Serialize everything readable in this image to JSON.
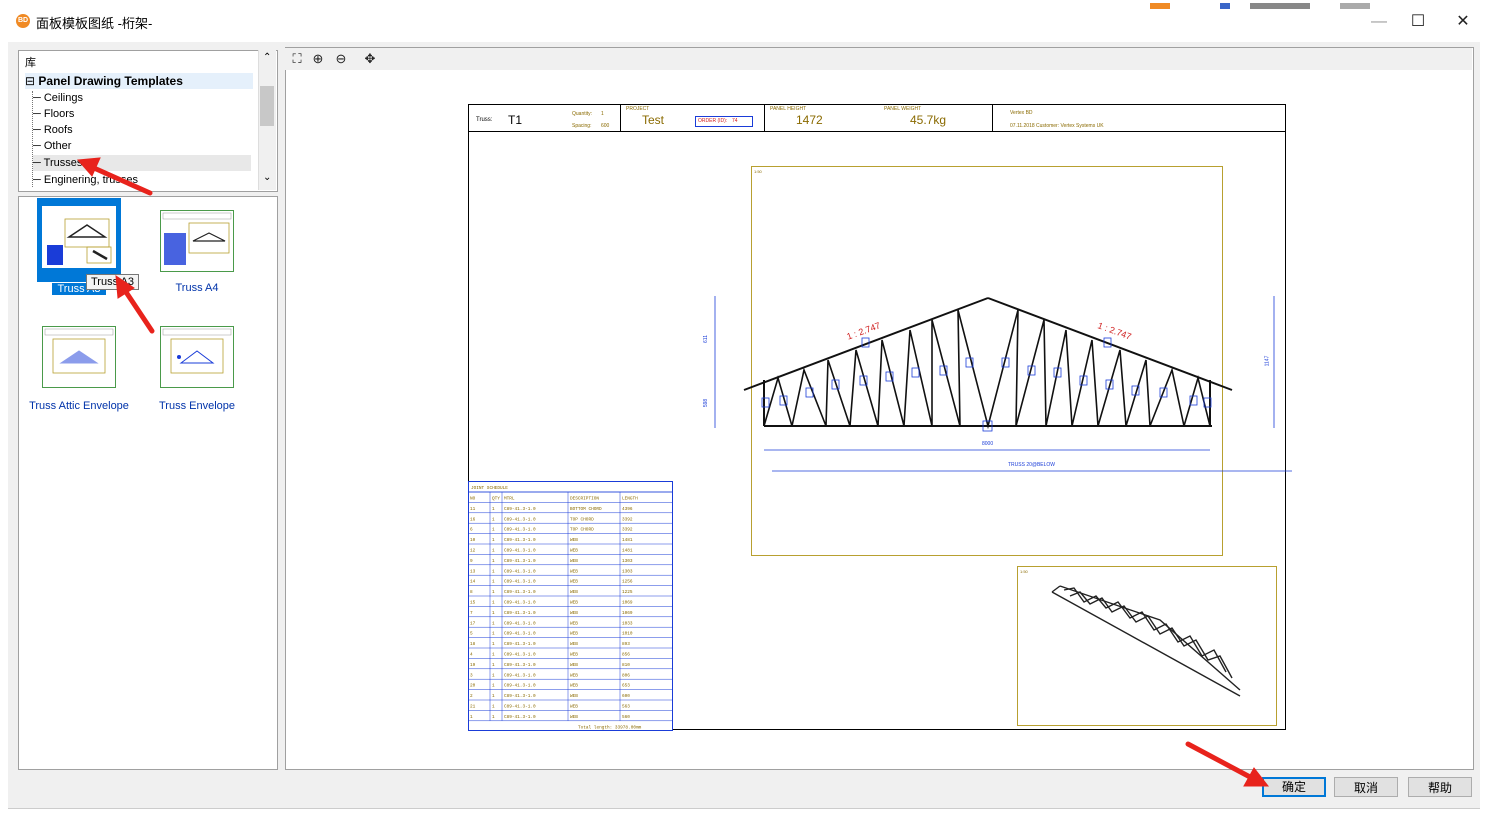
{
  "window": {
    "app_icon_text": "BD",
    "title": "面板模板图纸 -桁架-",
    "controls": {
      "minimize": "—",
      "maximize": "☐",
      "close": "✕"
    }
  },
  "library": {
    "header": "库",
    "root": {
      "expander": "⊟",
      "label": "Panel Drawing Templates"
    },
    "items": [
      "Ceilings",
      "Floors",
      "Roofs",
      "Other",
      "Trusses",
      "Enginering, trusses"
    ],
    "selected": "Trusses"
  },
  "templates": {
    "items": [
      {
        "label": "Truss A3",
        "selected": true
      },
      {
        "label": "Truss A4",
        "selected": false
      },
      {
        "label": "Truss Attic Envelope",
        "selected": false
      },
      {
        "label": "Truss Envelope",
        "selected": false
      }
    ],
    "tooltip": "Truss A3"
  },
  "preview_toolbar": {
    "icons": [
      "zoom-extents-icon",
      "zoom-in-icon",
      "zoom-out-icon",
      "pan-icon"
    ]
  },
  "drawing": {
    "header": {
      "truss_label": "Truss:",
      "truss_value": "T1",
      "quantity_label": "Quantity:",
      "quantity_value": "1",
      "spacing_label": "Spacing:",
      "spacing_value": "600",
      "project_label": "PROJECT",
      "project_value": "Test",
      "order_label": "ORDER (ID):",
      "order_value": "74",
      "panel_height_label": "PANEL HEIGHT",
      "panel_height_value": "1472",
      "panel_weight_label": "PANEL WEIGHT",
      "panel_weight_value": "45.7kg",
      "vertex_label": "Vertex BD",
      "date_customer": "07.11.2018   Customer: Vertex Systems UK"
    },
    "dims": {
      "pitch_left": "1 : 2.747",
      "pitch_right": "1 : 2.747",
      "span": "8000",
      "bottom_label": "TRUSS 20@BELOW",
      "left_top": "611",
      "left_bottom": "598",
      "right": "1147",
      "view_label": "1:50",
      "iso_label": "1:50"
    },
    "parts_table": {
      "title": "JOINT SCHEDULE",
      "headers": [
        "NO",
        "QTY",
        "MTRL",
        "DESCRIPTION",
        "LENGTH"
      ],
      "rows": [
        [
          "11",
          "1",
          "C89-41.3-1.0",
          "BOTTOM CHORD",
          "4396"
        ],
        [
          "16",
          "1",
          "C89-41.3-1.0",
          "TOP CHORD",
          "3392"
        ],
        [
          "6",
          "1",
          "C89-41.3-1.0",
          "TOP CHORD",
          "3392"
        ],
        [
          "10",
          "1",
          "C89-41.3-1.0",
          "WEB",
          "1481"
        ],
        [
          "12",
          "1",
          "C89-41.3-1.0",
          "WEB",
          "1481"
        ],
        [
          "9",
          "1",
          "C89-41.3-1.0",
          "WEB",
          "1303"
        ],
        [
          "13",
          "1",
          "C89-41.3-1.0",
          "WEB",
          "1303"
        ],
        [
          "14",
          "1",
          "C89-41.3-1.0",
          "WEB",
          "1256"
        ],
        [
          "8",
          "1",
          "C89-41.3-1.0",
          "WEB",
          "1225"
        ],
        [
          "15",
          "1",
          "C89-41.3-1.0",
          "WEB",
          "1069"
        ],
        [
          "7",
          "1",
          "C89-41.3-1.0",
          "WEB",
          "1069"
        ],
        [
          "17",
          "1",
          "C89-41.3-1.0",
          "WEB",
          "1033"
        ],
        [
          "5",
          "1",
          "C89-41.3-1.0",
          "WEB",
          "1010"
        ],
        [
          "18",
          "1",
          "C89-41.3-1.0",
          "WEB",
          "893"
        ],
        [
          "4",
          "1",
          "C89-41.3-1.0",
          "WEB",
          "856"
        ],
        [
          "19",
          "1",
          "C89-41.3-1.0",
          "WEB",
          "810"
        ],
        [
          "3",
          "1",
          "C89-41.3-1.0",
          "WEB",
          "806"
        ],
        [
          "20",
          "1",
          "C89-41.3-1.0",
          "WEB",
          "653"
        ],
        [
          "2",
          "1",
          "C89-41.3-1.0",
          "WEB",
          "600"
        ],
        [
          "21",
          "1",
          "C89-41.3-1.0",
          "WEB",
          "563"
        ],
        [
          "1",
          "1",
          "C89-41.3-1.0",
          "WEB",
          "560"
        ]
      ],
      "total": "Total length: 33978.00mm"
    }
  },
  "buttons": {
    "ok": "确定",
    "cancel": "取消",
    "help": "帮助"
  },
  "colors": {
    "arrow": "#e8231c",
    "selection": "#0078d7",
    "frame": "#b8a030",
    "dimension": "#1a3cd8",
    "label_red": "#d02020"
  }
}
